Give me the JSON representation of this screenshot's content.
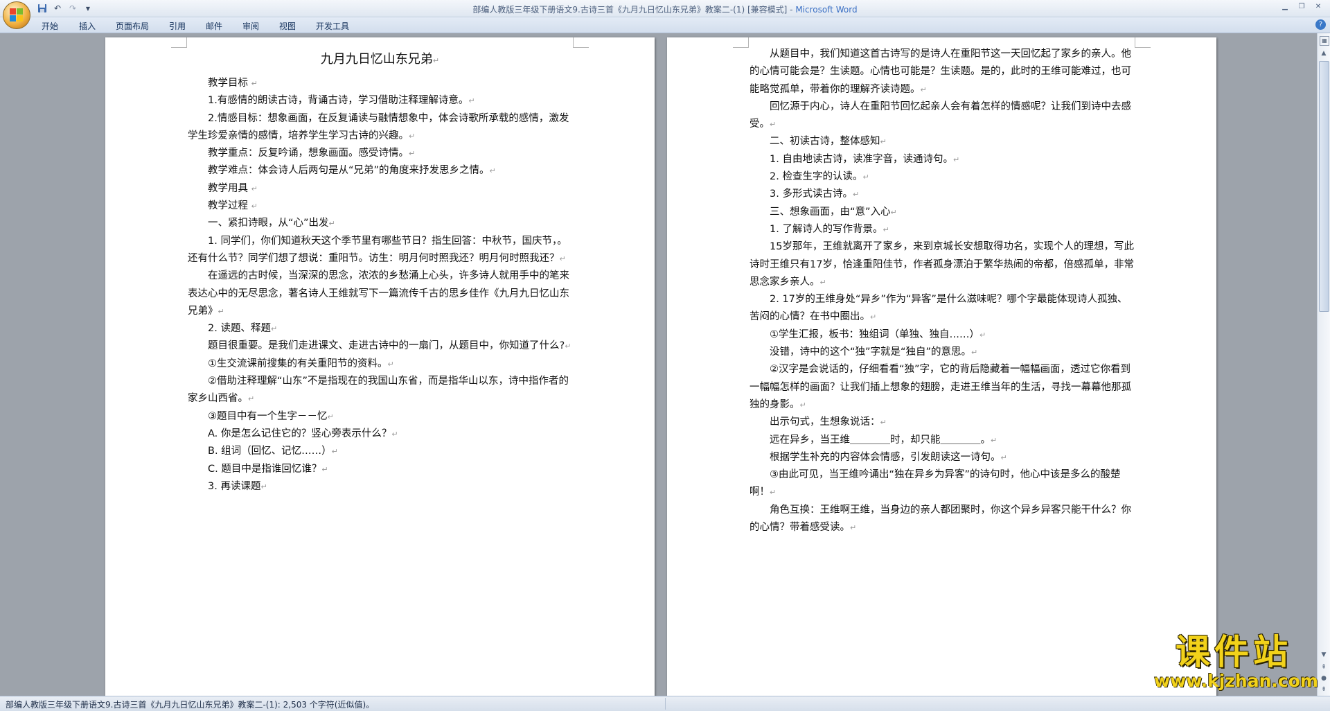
{
  "window": {
    "title": "部编人教版三年级下册语文9.古诗三首《九月九日忆山东兄弟》教案二-(1) [兼容模式]",
    "app_name": "Microsoft Word"
  },
  "quick_access": {
    "save_icon": "save-icon",
    "undo_icon": "undo-icon",
    "redo_icon": "redo-icon",
    "customize_icon": "dropdown-icon"
  },
  "ribbon": {
    "tabs": [
      "开始",
      "插入",
      "页面布局",
      "引用",
      "邮件",
      "审阅",
      "视图",
      "开发工具"
    ]
  },
  "document": {
    "left_page": [
      {
        "text": "九月九日忆山东兄弟",
        "style": "center"
      },
      {
        "text": "教学目标 "
      },
      {
        "text": "1.有感情的朗读古诗，背诵古诗，学习借助注释理解诗意。"
      },
      {
        "text": "2.情感目标：想象画面，在反复诵读与融情想象中，体会诗歌所承载的感情，激发学生珍爱亲情的感情，培养学生学习古诗的兴趣。"
      },
      {
        "text": "教学重点：反复吟诵，想象画面。感受诗情。"
      },
      {
        "text": "教学难点：体会诗人后两句是从“兄弟”的角度来抒发思乡之情。"
      },
      {
        "text": "教学用具 "
      },
      {
        "text": "教学过程 "
      },
      {
        "text": "一、紧扣诗眼，从“心”出发"
      },
      {
        "text": "1. 同学们，你们知道秋天这个季节里有哪些节日？指生回答：中秋节，国庆节，。还有什么节？同学们想了想说：重阳节。访生：明月何时照我还？明月何时照我还？"
      },
      {
        "text": "在遥远的古时候，当深深的思念，浓浓的乡愁涌上心头，许多诗人就用手中的笔来表达心中的无尽思念，著名诗人王维就写下一篇流传千古的思乡佳作《九月九日忆山东兄弟》"
      },
      {
        "text": "2. 读题、释题"
      },
      {
        "text": "题目很重要。是我们走进课文、走进古诗中的一扇门，从题目中，你知道了什么?"
      },
      {
        "text": "①生交流课前搜集的有关重阳节的资料。"
      },
      {
        "text": "②借助注释理解“山东”不是指现在的我国山东省，而是指华山以东，诗中指作者的家乡山西省。"
      },
      {
        "text": "③题目中有一个生字－－忆"
      },
      {
        "text": "A. 你是怎么记住它的？竖心旁表示什么？"
      },
      {
        "text": "B. 组词（回忆、记忆……）"
      },
      {
        "text": "C. 题目中是指谁回忆谁？"
      },
      {
        "text": "3. 再读课题"
      }
    ],
    "right_page": [
      {
        "text": "从题目中，我们知道这首古诗写的是诗人在重阳节这一天回忆起了家乡的亲人。他的心情可能会是？生读题。心情也可能是？生读题。是的，此时的王维可能难过，也可能略觉孤单，带着你的理解齐读诗题。"
      },
      {
        "text": "回忆源于内心，诗人在重阳节回忆起亲人会有着怎样的情感呢？让我们到诗中去感受。"
      },
      {
        "text": "二、初读古诗，整体感知"
      },
      {
        "text": "1. 自由地读古诗，读准字音，读通诗句。"
      },
      {
        "text": "2. 检查生字的认读。"
      },
      {
        "text": "3. 多形式读古诗。"
      },
      {
        "text": "三、想象画面，由“意”入心"
      },
      {
        "text": "1. 了解诗人的写作背景。"
      },
      {
        "text": "15岁那年，王维就离开了家乡，来到京城长安想取得功名，实现个人的理想，写此诗时王维只有17岁，恰逢重阳佳节，作者孤身漂泊于繁华热闹的帝都，倍感孤单，非常思念家乡亲人。"
      },
      {
        "text": "2. 17岁的王维身处“异乡”作为“异客”是什么滋味呢？哪个字最能体现诗人孤独、苦闷的心情？在书中圈出。"
      },
      {
        "text": "①学生汇报，板书：独组词（单独、独自……）"
      },
      {
        "text": "没错，诗中的这个“独”字就是“独自”的意思。"
      },
      {
        "text": "②汉字是会说话的，仔细看看“独”字，它的背后隐藏着一幅幅画面，透过它你看到一幅幅怎样的画面？让我们插上想象的翅膀，走进王维当年的生活，寻找一幕幕他那孤独的身影。"
      },
      {
        "text": "出示句式，生想象说话："
      },
      {
        "text": "远在异乡，当王维＿＿＿＿时，却只能＿＿＿＿。"
      },
      {
        "text": "根据学生补充的内容体会情感，引发朗读这一诗句。"
      },
      {
        "text": "③由此可见，当王维吟诵出“独在异乡为异客”的诗句时，他心中该是多么的酸楚啊！"
      },
      {
        "text": "角色互换：王维啊王维，当身边的亲人都团聚时，你这个异乡异客只能干什么？你的心情？带着感受读。"
      }
    ],
    "paragraph_mark": "↵"
  },
  "status_bar": {
    "text": "部编人教版三年级下册语文9.古诗三首《九月九日忆山东兄弟》教案二-(1): 2,503 个字符(近似值)。"
  },
  "watermark": {
    "title": "课件站",
    "url": "www.kjzhan.com"
  },
  "colors": {
    "app_name": "#3a6fc4",
    "watermark": "#f2d21a"
  }
}
